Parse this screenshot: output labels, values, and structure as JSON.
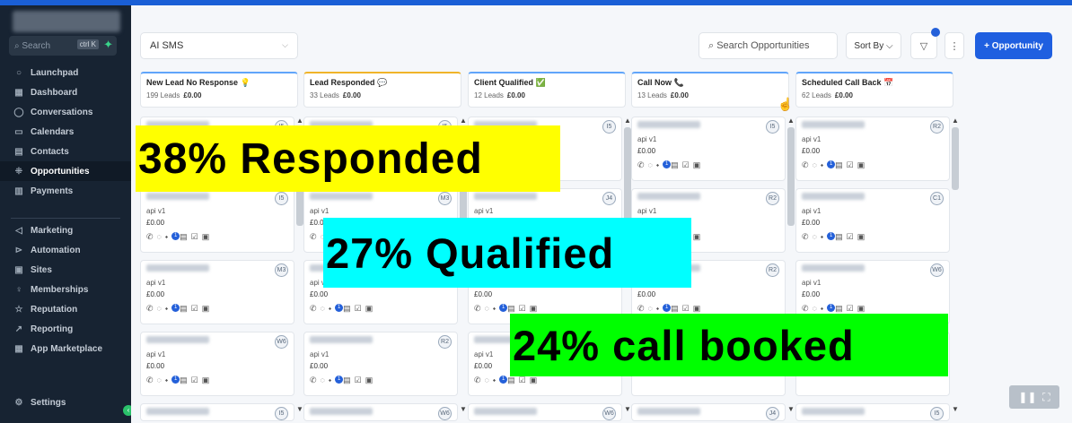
{
  "sidebar": {
    "search_placeholder": "Search",
    "search_kbd": "ctrl K",
    "items": [
      {
        "label": "Launchpad",
        "icon": "○"
      },
      {
        "label": "Dashboard",
        "icon": "▦"
      },
      {
        "label": "Conversations",
        "icon": "◯"
      },
      {
        "label": "Calendars",
        "icon": "▭"
      },
      {
        "label": "Contacts",
        "icon": "▤"
      },
      {
        "label": "Opportunities",
        "icon": "⁜"
      },
      {
        "label": "Payments",
        "icon": "▥"
      },
      {
        "label": "Marketing",
        "icon": "◁"
      },
      {
        "label": "Automation",
        "icon": "⊳"
      },
      {
        "label": "Sites",
        "icon": "▣"
      },
      {
        "label": "Memberships",
        "icon": "♀"
      },
      {
        "label": "Reputation",
        "icon": "☆"
      },
      {
        "label": "Reporting",
        "icon": "↗"
      },
      {
        "label": "App Marketplace",
        "icon": "▦"
      },
      {
        "label": "Settings",
        "icon": "⚙"
      }
    ]
  },
  "toolbar": {
    "pipeline": "AI SMS",
    "search_placeholder": "Search Opportunities",
    "sort_label": "Sort By",
    "add_label": "+ Opportunity"
  },
  "stages": [
    {
      "title": "New Lead No Response",
      "emoji": "💡",
      "leads": "199 Leads",
      "amount": "£0.00",
      "color": "#60a5fa"
    },
    {
      "title": "Lead Responded",
      "emoji": "💬",
      "leads": "33 Leads",
      "amount": "£0.00",
      "color": "#f0b429"
    },
    {
      "title": "Client Qualified",
      "emoji": "✅",
      "leads": "12 Leads",
      "amount": "£0.00",
      "color": "#60a5fa"
    },
    {
      "title": "Call Now",
      "emoji": "📞",
      "leads": "13 Leads",
      "amount": "£0.00",
      "color": "#60a5fa"
    },
    {
      "title": "Scheduled Call Back",
      "emoji": "📅",
      "leads": "62 Leads",
      "amount": "£0.00",
      "color": "#60a5fa"
    }
  ],
  "cards": [
    [
      {
        "badge": "I5",
        "src": "api v1",
        "amt": "£0.00"
      },
      {
        "badge": "I5",
        "src": "api v1",
        "amt": "£0.00"
      },
      {
        "badge": "M3",
        "src": "api v1",
        "amt": "£0.00"
      },
      {
        "badge": "W6",
        "src": "api v1",
        "amt": "£0.00"
      }
    ],
    [
      {
        "badge": "I5",
        "src": "api v1",
        "amt": "£0.00"
      },
      {
        "badge": "M3",
        "src": "api v1",
        "amt": "£0.00"
      },
      {
        "badge": "",
        "src": "api v1",
        "amt": "£0.00"
      },
      {
        "badge": "R2",
        "src": "api v1",
        "amt": "£0.00"
      }
    ],
    [
      {
        "badge": "I5",
        "src": "api v1",
        "amt": "£0.00"
      },
      {
        "badge": "J4",
        "src": "api v1",
        "amt": "£0.00"
      },
      {
        "badge": "",
        "src": "api v1",
        "amt": "£0.00"
      },
      {
        "badge": "",
        "src": "api v1",
        "amt": "£0.00"
      }
    ],
    [
      {
        "badge": "I5",
        "src": "api v1",
        "amt": "£0.00"
      },
      {
        "badge": "R2",
        "src": "api v1",
        "amt": "£0.00"
      },
      {
        "badge": "R2",
        "src": "api v1",
        "amt": "£0.00"
      },
      {
        "badge": "",
        "src": "",
        "amt": ""
      }
    ],
    [
      {
        "badge": "R2",
        "src": "api v1",
        "amt": "£0.00"
      },
      {
        "badge": "C1",
        "src": "api v1",
        "amt": "£0.00"
      },
      {
        "badge": "W6",
        "src": "api v1",
        "amt": "£0.00"
      },
      {
        "badge": "",
        "src": "",
        "amt": ""
      }
    ]
  ],
  "bottom_badges": [
    "I5",
    "W6",
    "W6",
    "J4",
    "I5"
  ],
  "overlays": {
    "responded": "38% Responded",
    "qualified": "27% Qualified",
    "booked": "24% call booked"
  }
}
